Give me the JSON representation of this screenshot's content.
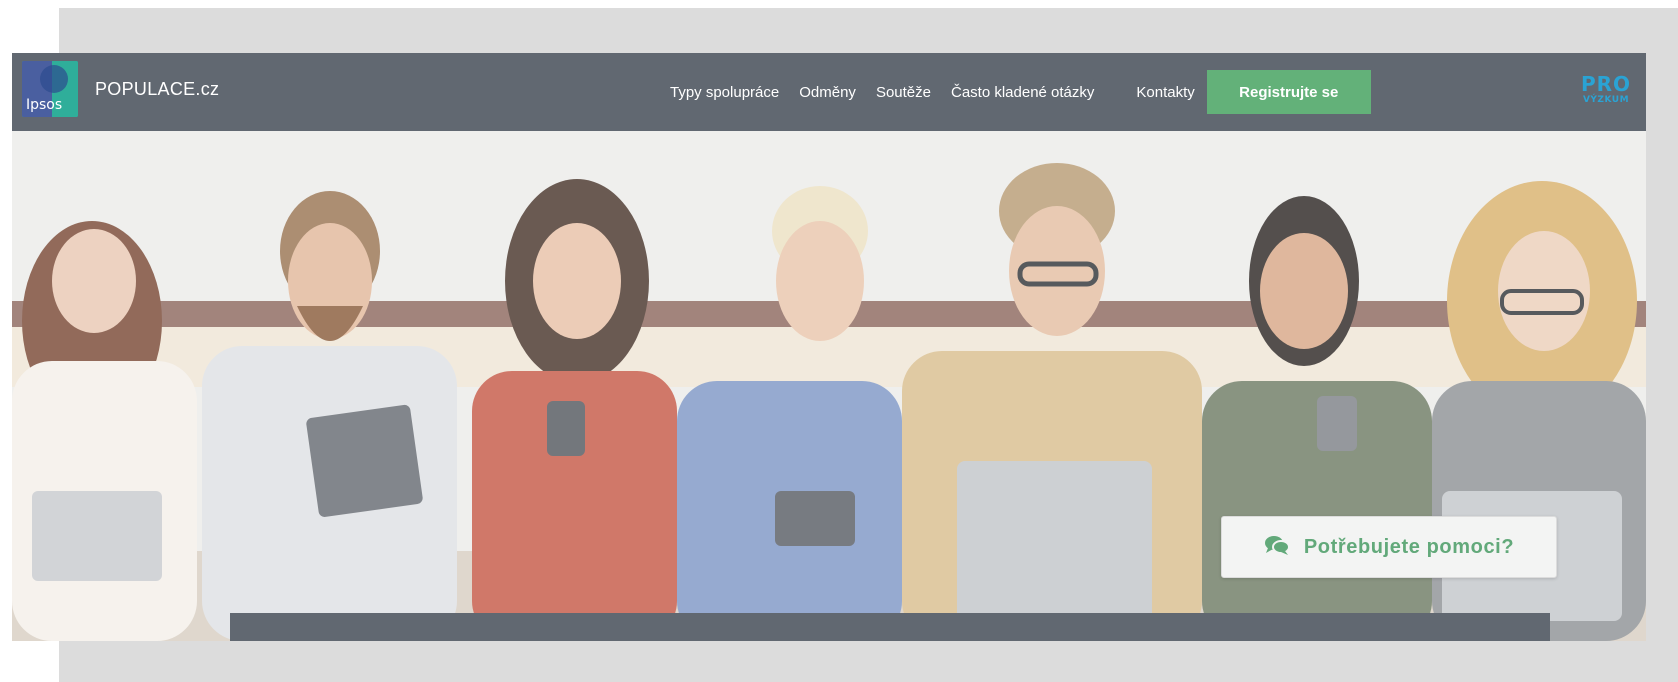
{
  "header": {
    "logo_text": "Ipsos",
    "brand": "POPULACE.cz",
    "nav": [
      {
        "label": "Typy spolupráce"
      },
      {
        "label": "Odměny"
      },
      {
        "label": "Soutěže"
      },
      {
        "label": "Často kladené otázky"
      },
      {
        "label": "Kontakty"
      }
    ],
    "register_label": "Registrujte se",
    "partner_logo": {
      "top": "PRO",
      "bottom": "VÝZKUM"
    }
  },
  "help": {
    "label": "Potřebujete pomoci?",
    "icon": "chat-bubbles-icon"
  },
  "colors": {
    "navbar": "#616871",
    "accent_green": "#63b179",
    "help_text": "#62a97a",
    "partner_blue": "#2aa3d4"
  }
}
